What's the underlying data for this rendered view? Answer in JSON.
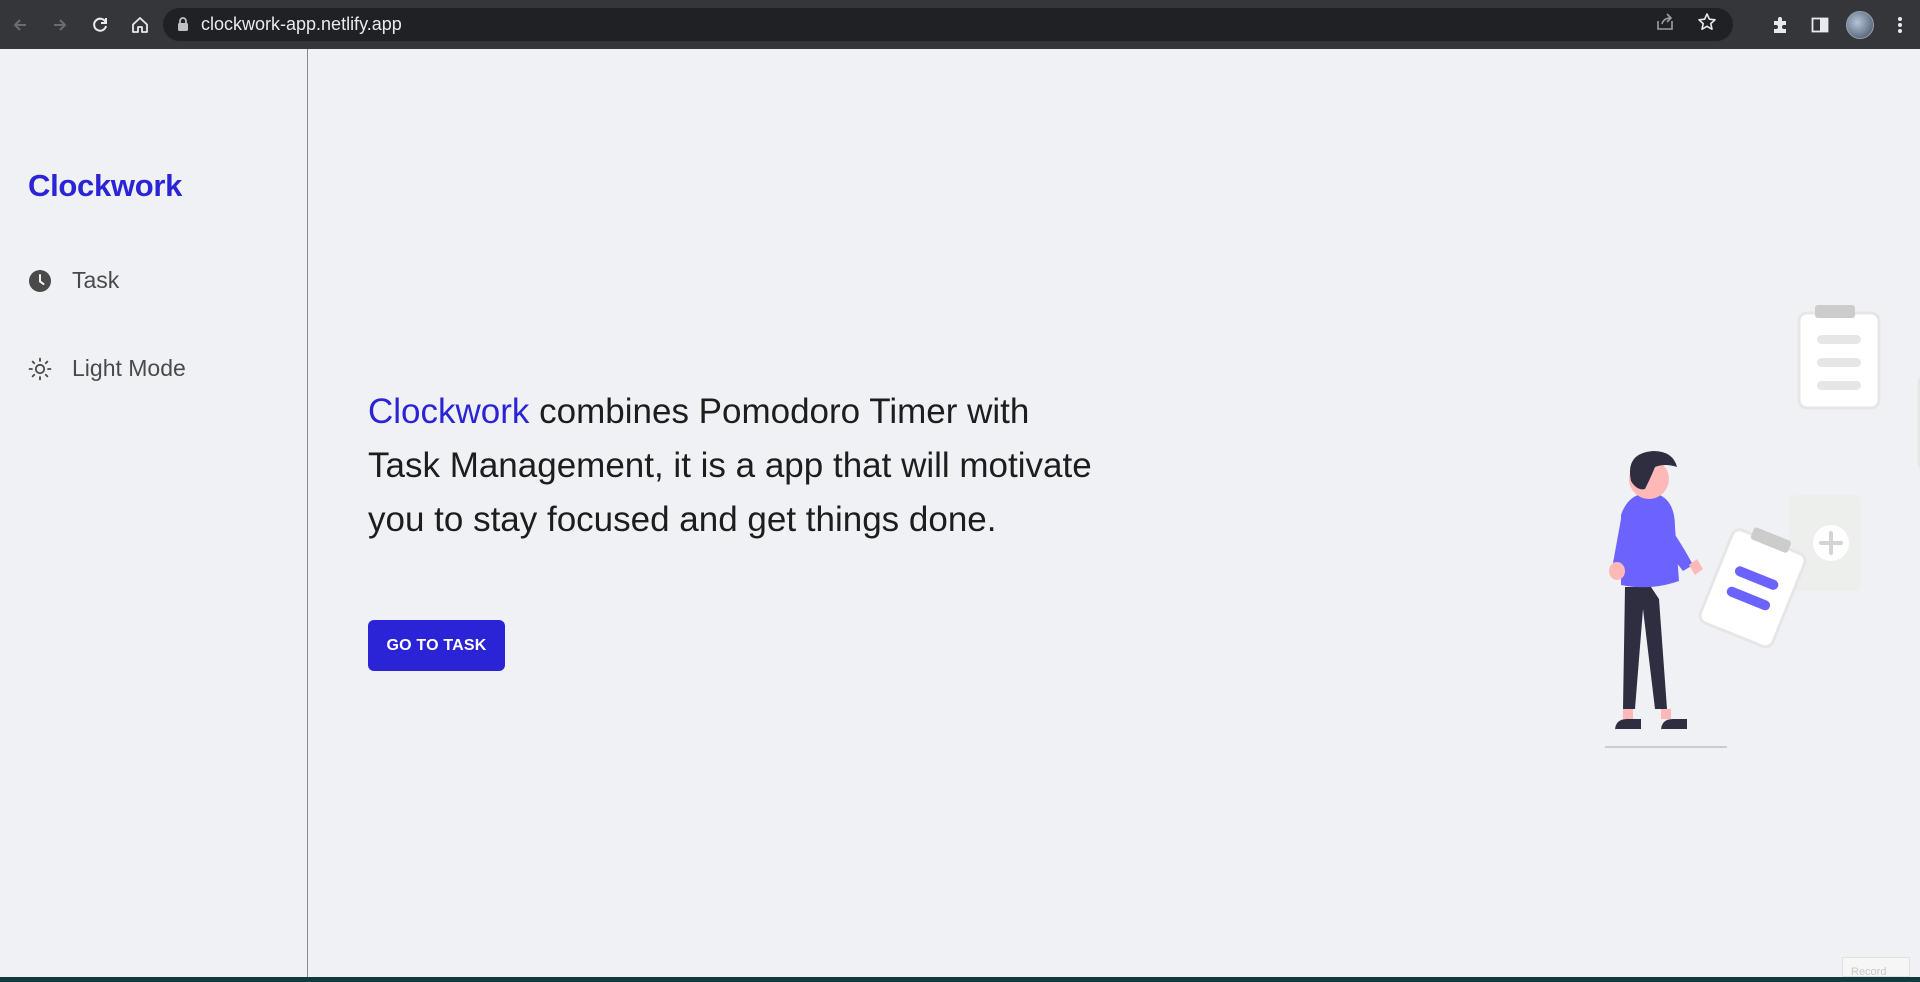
{
  "browser": {
    "url": "clockwork-app.netlify.app",
    "icons": {
      "back": "arrow-left-icon",
      "forward": "arrow-right-icon",
      "reload": "reload-icon",
      "home": "home-icon",
      "lock": "lock-icon",
      "share": "share-icon",
      "bookmark": "star-icon",
      "extensions": "puzzle-icon",
      "side_panel": "side-panel-icon",
      "profile": "avatar",
      "menu": "kebab-menu-icon"
    }
  },
  "sidebar": {
    "brand": "Clockwork",
    "items": [
      {
        "label": "Task",
        "icon": "clock-icon"
      },
      {
        "label": "Light Mode",
        "icon": "sun-icon"
      }
    ]
  },
  "hero": {
    "brand_word": "Clockwork",
    "text": " combines Pomodoro Timer with Task Management, it is a app that will motivate you to stay focused and get things done.",
    "cta_label": "GO TO TASK"
  },
  "overlay": {
    "record_label": "Record"
  },
  "colors": {
    "accent": "#2b23d6",
    "background": "#f0f1f5",
    "illustration_purple": "#6c63ff",
    "illustration_dark": "#2f2e41",
    "chrome_bar": "#35363a",
    "omnibox": "#202124"
  }
}
